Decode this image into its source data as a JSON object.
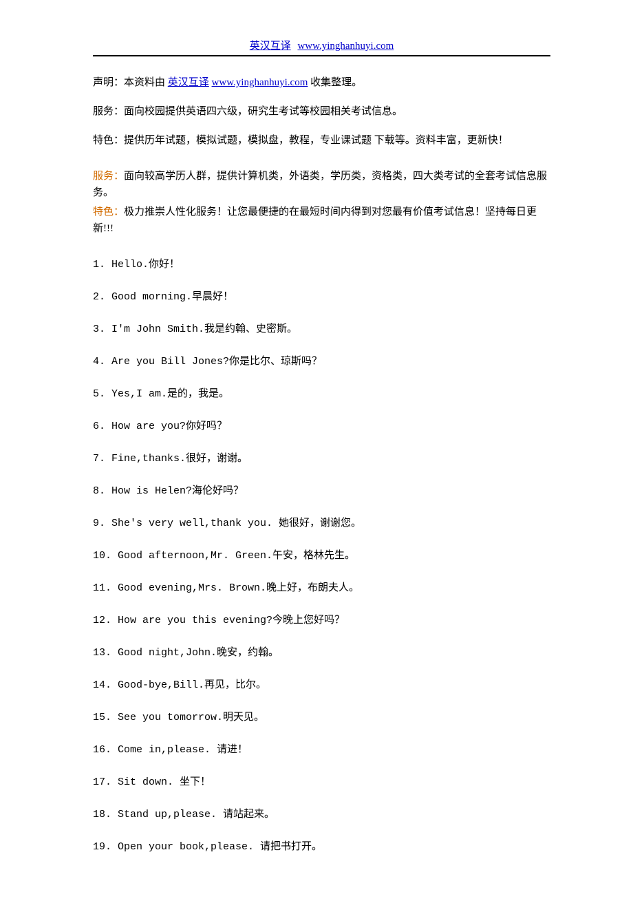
{
  "header": {
    "title_link": "英汉互译",
    "url": "www.yinghanhuyi.com"
  },
  "intro": {
    "line1_pre": "声明：本资料由 ",
    "line1_link1": "英汉互译",
    "line1_link2": "www.yinghanhuyi.com",
    "line1_post": "  收集整理。",
    "line2": "服务：面向校园提供英语四六级，研究生考试等校园相关考试信息。",
    "line3": "特色：提供历年试题，模拟试题，模拟盘，教程，专业课试题  下载等。资料丰富，更新快！"
  },
  "promo": {
    "line1_label": "服务：",
    "line1_text": "面向较高学历人群，提供计算机类，外语类，学历类，资格类，四大类考试的全套考试信息服务。",
    "line2_label": "特色：",
    "line2_text": "极力推崇人性化服务！让您最便捷的在最短时间内得到对您最有价值考试信息！坚持每日更新!!!"
  },
  "items": [
    {
      "en": "1. Hello.",
      "zh": "你好！"
    },
    {
      "en": "2. Good morning.",
      "zh": "早晨好！"
    },
    {
      "en": "3. I'm John Smith.",
      "zh": "我是约翰、史密斯。"
    },
    {
      "en": "4. Are you Bill Jones?",
      "zh": "你是比尔、琼斯吗？"
    },
    {
      "en": "5. Yes,I am.",
      "zh": "是的，我是。"
    },
    {
      "en": "6. How are you?",
      "zh": "你好吗？"
    },
    {
      "en": "7. Fine,thanks.",
      "zh": "很好，谢谢。"
    },
    {
      "en": "8. How is Helen?",
      "zh": "海伦好吗？"
    },
    {
      "en": "9. She's very well,thank you. ",
      "zh": "她很好，谢谢您。"
    },
    {
      "en": "10. Good afternoon,Mr. Green.",
      "zh": "午安，格林先生。"
    },
    {
      "en": "11. Good evening,Mrs. Brown.",
      "zh": "晚上好，布朗夫人。"
    },
    {
      "en": "12. How are you this evening?",
      "zh": "今晚上您好吗？"
    },
    {
      "en": "13. Good night,John.",
      "zh": "晚安，约翰。"
    },
    {
      "en": "14. Good-bye,Bill.",
      "zh": "再见，比尔。"
    },
    {
      "en": "15. See you tomorrow.",
      "zh": "明天见。"
    },
    {
      "en": "16. Come in,please. ",
      "zh": "请进！"
    },
    {
      "en": "17. Sit down. ",
      "zh": "坐下！"
    },
    {
      "en": "18. Stand up,please. ",
      "zh": "请站起来。"
    },
    {
      "en": "19. Open your book,please. ",
      "zh": "请把书打开。"
    }
  ]
}
